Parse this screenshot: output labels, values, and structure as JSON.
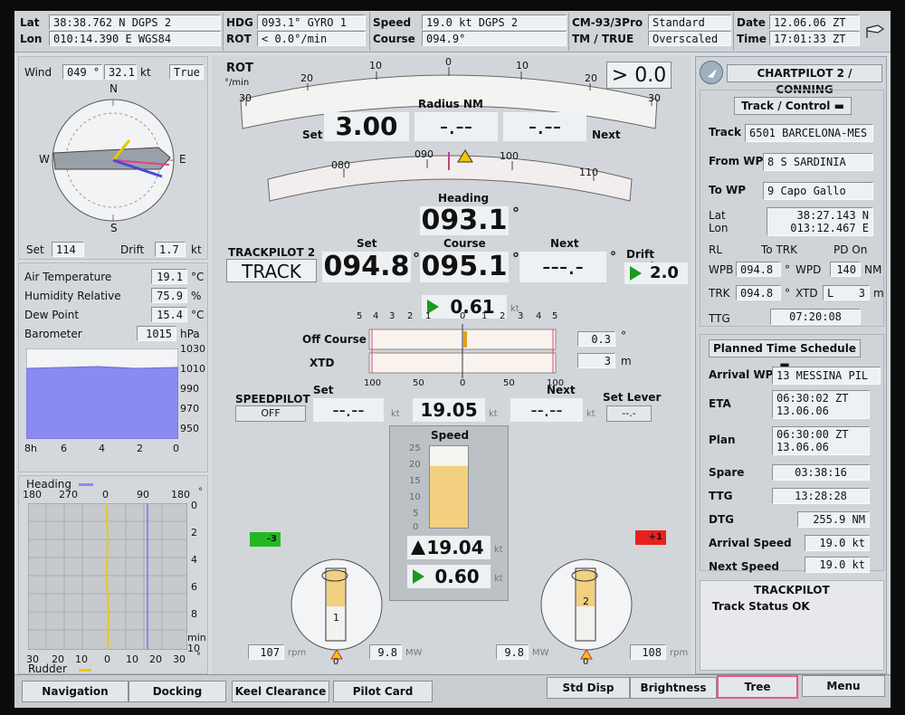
{
  "top": {
    "lat_label": "Lat",
    "lat_value": "38:38.762 N DGPS 2",
    "lon_label": "Lon",
    "lon_value": "010:14.390 E WGS84",
    "hdg_label": "HDG",
    "hdg_value": "093.1° GYRO 1",
    "rot_label": "ROT",
    "rot_value": "<  0.0°/min",
    "speed_label": "Speed",
    "speed_value": "19.0  kt DGPS 2",
    "course_label": "Course",
    "course_value": "094.9°",
    "cm_label": "CM-93/3Pro",
    "tm_label": "TM / TRUE",
    "std_value": "Standard",
    "overscaled_value": "Overscaled",
    "date_label": "Date",
    "date_value": "12.06.06 ZT",
    "time_label": "Time",
    "time_value": "17:01:33 ZT"
  },
  "left": {
    "wind_label": "Wind",
    "wind_dir": "049 °",
    "wind_speed": "32.1",
    "wind_unit": "kt",
    "wind_ref": "True",
    "compass_n": "N",
    "compass_e": "E",
    "compass_s": "S",
    "compass_w": "W",
    "set_label": "Set",
    "set_value": "114 °",
    "drift_label": "Drift",
    "drift_value": "1.7",
    "drift_unit": "kt",
    "air_temp_label": "Air Temperature",
    "air_temp_value": "19.1",
    "air_temp_unit": "°C",
    "humidity_label": "Humidity Relative",
    "humidity_value": "75.9",
    "humidity_unit": "%",
    "dew_label": "Dew Point",
    "dew_value": "15.4",
    "dew_unit": "°C",
    "baro_label": "Barometer",
    "baro_value": "1015",
    "baro_unit": "hPa",
    "baro_yticks": [
      "1030",
      "1010",
      "990",
      "970",
      "950"
    ],
    "baro_xticks": [
      "8h",
      "6",
      "4",
      "2",
      "0"
    ],
    "heading_legend": "Heading",
    "hdg_xticks": [
      "180",
      "270",
      "0",
      "90",
      "180",
      "°"
    ],
    "hdg_yticks": [
      "0",
      "2",
      "4",
      "6",
      "8",
      "10"
    ],
    "min_label": "min",
    "rudder_xticks": [
      "30",
      "20",
      "10",
      "0",
      "10",
      "20",
      "30",
      "°"
    ],
    "rudder_legend": "Rudder"
  },
  "center": {
    "rot_title": "ROT",
    "rot_unit": "°/min",
    "rot_value": ">  0.0",
    "rot_scale": [
      "30",
      "20",
      "10",
      "0",
      "10",
      "20",
      "30"
    ],
    "radius_label": "Radius  NM",
    "set_label": "Set",
    "radius_set": "3.00",
    "radius_mid": "-.--",
    "radius_next": "-.--",
    "next_label": "Next",
    "hdg_scale": [
      "080",
      "090",
      "100",
      "110"
    ],
    "heading_label": "Heading",
    "heading_value": "093.1",
    "deg": "°",
    "trackpilot_label": "TRACKPILOT 2",
    "track_mode": "TRACK",
    "course_set_label": "Set",
    "course_set": "094.8",
    "course_label": "Course",
    "course_value": "095.1",
    "course_next_label": "Next",
    "course_next": "---.-",
    "drift_angle_label": "Drift Angle",
    "drift_angle": "2.0",
    "speed_over_value": "0.61",
    "kt": "kt",
    "xtd_scale_top": [
      "5",
      "4",
      "3",
      "2",
      "1",
      "0",
      "1",
      "2",
      "3",
      "4",
      "5"
    ],
    "off_course_label": "Off Course",
    "off_course_value": "0.3",
    "off_course_unit": "°",
    "xtd_label": "XTD",
    "xtd_value": "3",
    "xtd_unit": "m",
    "xtd_scale_bottom": [
      "100",
      "50",
      "0",
      "50",
      "100"
    ],
    "speedpilot_label": "SPEEDPILOT",
    "speedpilot_state": "OFF",
    "sp_set_label": "Set",
    "sp_set": "--.--",
    "speed_value": "19.05",
    "sp_next_label": "Next",
    "sp_next": "--.--",
    "set_lever_label": "Set Lever",
    "set_lever_value": "--.-",
    "speed_bar_label": "Speed",
    "speed_scale": [
      "25",
      "20",
      "15",
      "10",
      "5",
      "0"
    ],
    "speed_fill": 0.76,
    "speed_ground": "19.04",
    "speed_accel": "0.60",
    "port_rudder": "-3",
    "stbd_rudder": "+1",
    "port_rpm": "107",
    "rpm": "rpm",
    "port_mw": "9.8",
    "mw": "MW",
    "stbd_mw": "9.8",
    "stbd_rpm": "108",
    "port_num": "1",
    "stbd_num": "2",
    "zero": "0"
  },
  "right": {
    "title": "CHARTPILOT 2 / CONNING",
    "track_control": "Track / Control",
    "track_label": "Track",
    "track_value": "6501 BARCELONA-MES",
    "from_wp_label": "From WP",
    "from_wp_value": "8 S SARDINIA",
    "to_wp_label": "To WP",
    "to_wp_value": "9 Capo Gallo",
    "lat_label": "Lat",
    "lon_label": "Lon",
    "lat_value": "38:27.143 N",
    "lon_value": "013:12.467 E",
    "rl_label": "RL",
    "to_trk_label": "To TRK",
    "pd_on_label": "PD On",
    "wpb_label": "WPB",
    "wpb_value": "094.8",
    "wpd_label": "WPD",
    "wpd_value": "140",
    "nm": "NM",
    "trk_label": "TRK",
    "trk_value": "094.8",
    "xtd_label": "XTD",
    "xtd_side": "L",
    "xtd_value": "3",
    "m": "m",
    "ttg_label": "TTG",
    "ttg_value": "07:20:08",
    "schedule": "Planned Time Schedule",
    "arrival_wp_label": "Arrival WP",
    "arrival_wp_value": "13 MESSINA PIL",
    "eta_label": "ETA",
    "eta_time": "06:30:02 ZT",
    "eta_date": "13.06.06",
    "plan_label": "Plan",
    "plan_time": "06:30:00 ZT",
    "plan_date": "13.06.06",
    "spare_label": "Spare",
    "spare_value": "03:38:16",
    "ttg2_label": "TTG",
    "ttg2_value": "13:28:28",
    "dtg_label": "DTG",
    "dtg_value": "255.9 NM",
    "arrival_speed_label": "Arrival Speed",
    "arrival_speed_value": "19.0 kt",
    "next_speed_label": "Next Speed",
    "next_speed_value": "19.0 kt",
    "trackpilot_title": "TRACKPILOT",
    "track_status": "Track Status OK"
  },
  "bottom": {
    "navigation": "Navigation",
    "docking": "Docking",
    "keel": "Keel Clearance",
    "pilot": "Pilot Card",
    "std_disp": "Std Disp",
    "brightness": "Brightness",
    "tree": "Tree",
    "menu": "Menu"
  }
}
